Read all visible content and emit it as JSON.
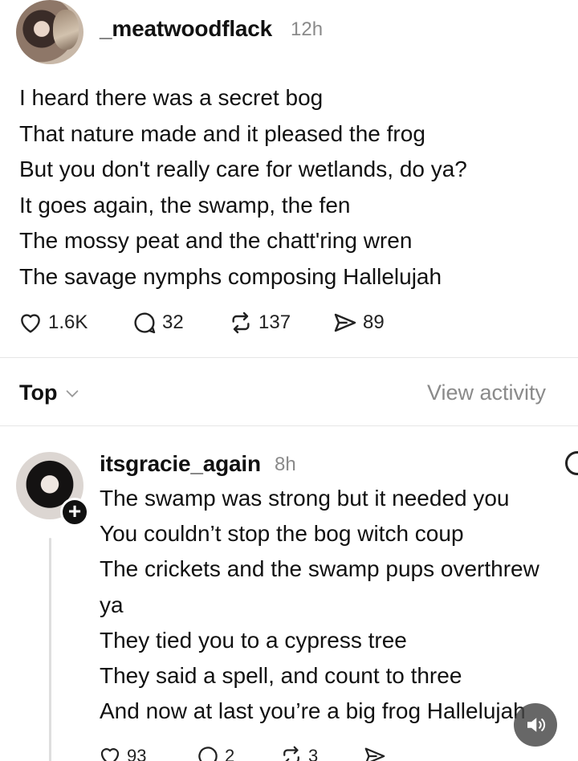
{
  "post": {
    "username": "_meatwoodflack",
    "time": "12h",
    "lines": [
      "I heard there was a secret bog",
      "That nature made and it pleased the frog",
      "But you don't really care for wetlands, do ya?",
      "It goes again, the swamp, the fen",
      "The mossy peat and the chatt'ring wren",
      "The savage nymphs composing Hallelujah"
    ],
    "likes": "1.6K",
    "replies": "32",
    "reposts": "137",
    "shares": "89"
  },
  "sort": {
    "label": "Top",
    "view_activity": "View activity"
  },
  "reply": {
    "username": "itsgracie_again",
    "time": "8h",
    "follow_symbol": "+",
    "lines": [
      "The swamp was strong but it needed you",
      "You couldn’t stop the bog witch coup",
      "The crickets and the swamp pups overthrew",
      "ya",
      "They tied you to a cypress tree",
      "They said a spell, and count to three",
      "And now at last you’re a big frog Hallelujah"
    ],
    "likes": "93",
    "replies": "2",
    "reposts": "3"
  },
  "icons": {
    "like": "heart-icon",
    "reply": "speech-bubble-icon",
    "repost": "repost-icon",
    "share": "send-icon",
    "sound": "speaker-icon"
  }
}
